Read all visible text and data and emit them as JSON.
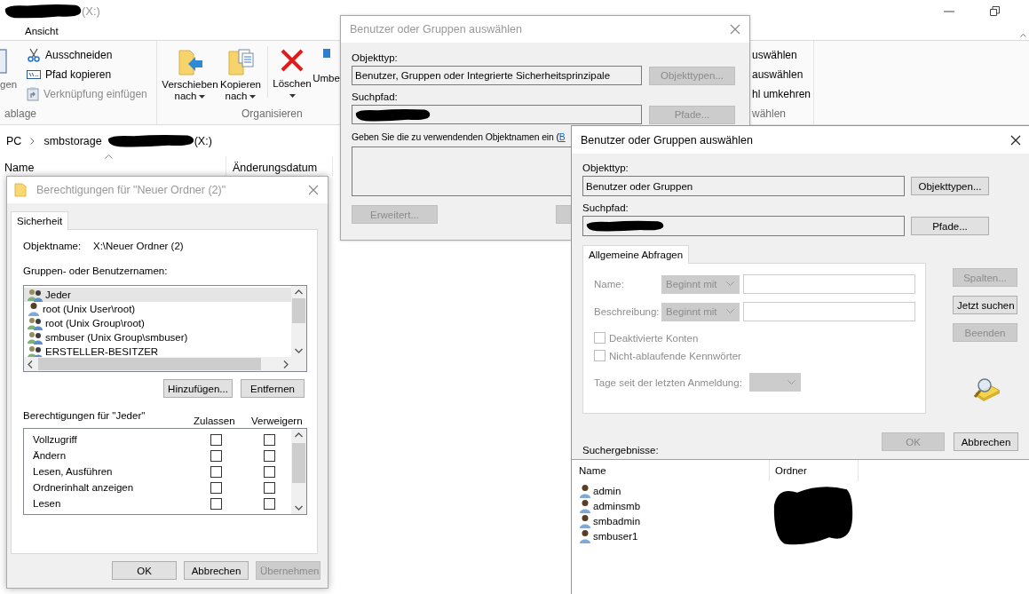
{
  "explorer": {
    "title": "(X:)",
    "tabs": [
      {
        "label": "Ansicht"
      }
    ],
    "clipboard": {
      "paste_label": "gen",
      "commands": [
        {
          "label": "Ausschneiden",
          "disabled": false
        },
        {
          "label": "Pfad kopieren",
          "disabled": false
        },
        {
          "label": "Verknüpfung einfügen",
          "disabled": true
        }
      ],
      "group_label": "ablage"
    },
    "organize": {
      "commands": [
        {
          "label": "Verschieben",
          "sublabel": "nach",
          "dropdown": true
        },
        {
          "label": "Kopieren",
          "sublabel": "nach",
          "dropdown": true
        },
        {
          "label": "Löschen",
          "dropdown": true
        },
        {
          "label": "Umbe",
          "dropdown": false
        }
      ],
      "group_label": "Organisieren"
    },
    "select": {
      "commands": [
        "uswählen",
        "auswählen",
        "hl umkehren"
      ],
      "group_label": "wählen"
    },
    "address": {
      "segments": [
        "PC",
        "smbstorage"
      ],
      "drive": "(X:)"
    },
    "columns": [
      "Name",
      "Änderungsdatum"
    ]
  },
  "permissions_dialog": {
    "title": "Berechtigungen für \"Neuer Ordner (2)\"",
    "tabs": [
      {
        "label": "Sicherheit",
        "selected": true
      }
    ],
    "object_label": "Objektname:",
    "object_name": "X:\\Neuer Ordner (2)",
    "groups_label": "Gruppen- oder Benutzernamen:",
    "principals": [
      {
        "name": "Jeder",
        "kind": "group",
        "selected": true
      },
      {
        "name": "root (Unix User\\root)",
        "kind": "user",
        "selected": false
      },
      {
        "name": "root (Unix Group\\root)",
        "kind": "group",
        "selected": false
      },
      {
        "name": "smbuser (Unix Group\\smbuser)",
        "kind": "group",
        "selected": false
      },
      {
        "name": "ERSTELLER-BESITZER",
        "kind": "group",
        "selected": false
      }
    ],
    "principal_buttons": [
      {
        "label": "Hinzufügen...",
        "disabled": false
      },
      {
        "label": "Entfernen",
        "disabled": false
      }
    ],
    "permissions_label": "Berechtigungen für \"Jeder\"",
    "permission_columns": [
      "Zulassen",
      "Verweigern"
    ],
    "permissions": [
      {
        "name": "Vollzugriff",
        "allow": false,
        "deny": false
      },
      {
        "name": "Ändern",
        "allow": false,
        "deny": false
      },
      {
        "name": "Lesen, Ausführen",
        "allow": false,
        "deny": false
      },
      {
        "name": "Ordnerinhalt anzeigen",
        "allow": false,
        "deny": false
      },
      {
        "name": "Lesen",
        "allow": false,
        "deny": false
      }
    ],
    "buttons": [
      {
        "label": "OK",
        "disabled": false
      },
      {
        "label": "Abbrechen",
        "disabled": false
      },
      {
        "label": "Übernehmen",
        "disabled": true
      }
    ]
  },
  "select_dialog_back": {
    "title": "Benutzer oder Gruppen auswählen",
    "object_type_label": "Objekttyp:",
    "object_type": "Benutzer, Gruppen oder Integrierte Sicherheitsprinzipale",
    "object_types_button": {
      "label": "Objekttypen...",
      "disabled": true
    },
    "search_path_label": "Suchpfad:",
    "paths_button": {
      "label": "Pfade...",
      "disabled": true
    },
    "names_prompt": "Geben Sie die zu verwendenden Objektnamen ein (",
    "names_link": "B",
    "buttons": [
      {
        "label": "Erweitert...",
        "disabled": true
      }
    ]
  },
  "select_dialog": {
    "title": "Benutzer oder Gruppen auswählen",
    "object_type_label": "Objekttyp:",
    "object_type": "Benutzer oder Gruppen",
    "object_types_button": {
      "label": "Objekttypen...",
      "disabled": false
    },
    "search_path_label": "Suchpfad:",
    "paths_button": {
      "label": "Pfade...",
      "disabled": false
    },
    "tabs": [
      {
        "label": "Allgemeine Abfragen",
        "selected": true
      }
    ],
    "query_disabled": true,
    "query_fields": [
      {
        "label": "Name:",
        "operator": "Beginnt mit"
      },
      {
        "label": "Beschreibung:",
        "operator": "Beginnt mit"
      }
    ],
    "options": [
      {
        "label": "Deaktivierte Konten",
        "checked": false
      },
      {
        "label": "Nicht-ablaufende Kennwörter",
        "checked": false
      }
    ],
    "days_label": "Tage seit der letzten Anmeldung:",
    "side_buttons": [
      {
        "label": "Spalten...",
        "disabled": true
      },
      {
        "label": "Jetzt suchen",
        "disabled": false
      },
      {
        "label": "Beenden",
        "disabled": true
      }
    ],
    "buttons": [
      {
        "label": "OK",
        "disabled": true
      },
      {
        "label": "Abbrechen",
        "disabled": false
      }
    ],
    "results_label": "Suchergebnisse:",
    "result_columns": [
      "Name",
      "Ordner"
    ],
    "results": [
      "admin",
      "adminsmb",
      "smbadmin",
      "smbuser1"
    ]
  }
}
